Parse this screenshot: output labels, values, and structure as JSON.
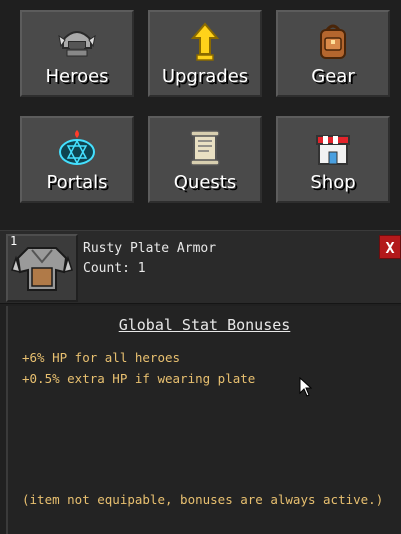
{
  "menu": {
    "buttons": [
      {
        "label": "Heroes",
        "icon": "helmet-icon"
      },
      {
        "label": "Upgrades",
        "icon": "up-arrow-icon"
      },
      {
        "label": "Gear",
        "icon": "backpack-icon"
      },
      {
        "label": "Portals",
        "icon": "portal-icon"
      },
      {
        "label": "Quests",
        "icon": "scroll-icon"
      },
      {
        "label": "Shop",
        "icon": "shop-icon"
      }
    ]
  },
  "item": {
    "slot_number": "1",
    "name": "Rusty Plate Armor",
    "count_text": "Count: 1",
    "close_label": "X"
  },
  "bonuses": {
    "title": "Global Stat Bonuses",
    "lines": [
      "+6% HP for all heroes",
      "+0.5% extra HP if wearing plate"
    ],
    "footer": "(item not equipable, bonuses are always active.)"
  },
  "colors": {
    "bonus_text": "#e8c070",
    "close_button": "#b3191b",
    "button_bg": "#4a4a4a"
  }
}
